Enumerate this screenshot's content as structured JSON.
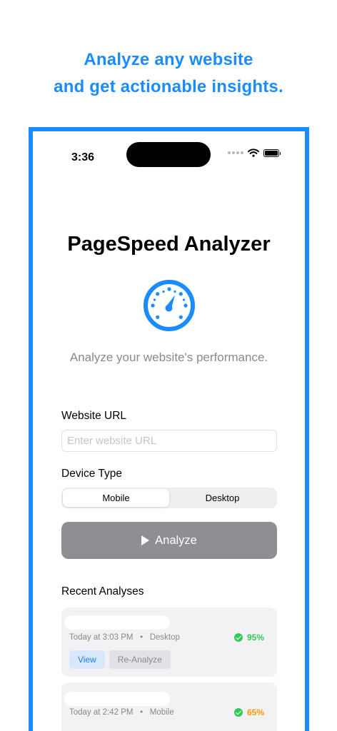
{
  "headline": {
    "line1": "Analyze any website",
    "line2": "and get actionable insights."
  },
  "status_bar": {
    "time": "3:36",
    "icons": [
      "signal-dots-icon",
      "wifi-icon",
      "battery-icon"
    ]
  },
  "app": {
    "title": "PageSpeed Analyzer",
    "logo_icon": "speedometer-icon",
    "subtitle": "Analyze your website's performance."
  },
  "form": {
    "url_label": "Website URL",
    "url_value": "",
    "url_placeholder": "Enter website URL",
    "device_label": "Device Type",
    "device_options": [
      "Mobile",
      "Desktop"
    ],
    "device_selected": "Mobile",
    "analyze_label": "Analyze",
    "analyze_icon": "play-icon"
  },
  "recent": {
    "heading": "Recent Analyses",
    "items": [
      {
        "time": "Today at 3:03 PM",
        "device": "Desktop",
        "score": "95%",
        "score_color": "#34c759",
        "view_label": "View",
        "reanalyze_label": "Re-Analyze"
      },
      {
        "time": "Today at 2:42 PM",
        "device": "Mobile",
        "score": "65%",
        "score_color": "#ff9500"
      }
    ]
  },
  "colors": {
    "accent": "#1a8cff",
    "button_disabled": "#8e8e93",
    "score_good": "#34c759",
    "score_average": "#ff9500"
  }
}
